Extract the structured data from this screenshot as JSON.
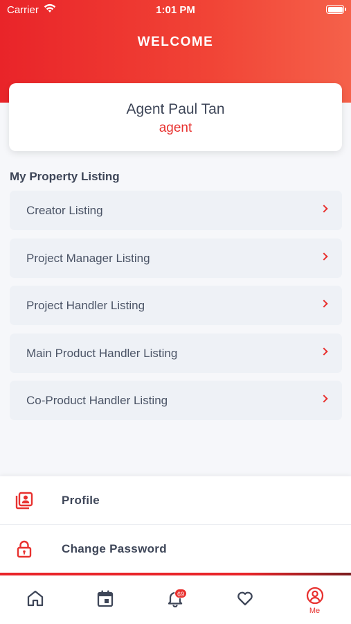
{
  "status_bar": {
    "carrier": "Carrier",
    "time": "1:01 PM"
  },
  "header": {
    "title": "WELCOME"
  },
  "user": {
    "name": "Agent Paul Tan",
    "role": "agent"
  },
  "listing_section": {
    "title": "My Property Listing",
    "items": [
      {
        "label": "Creator Listing"
      },
      {
        "label": "Project Manager Listing"
      },
      {
        "label": "Project Handler Listing"
      },
      {
        "label": "Main Product Handler Listing"
      },
      {
        "label": "Co-Product Handler Listing"
      }
    ]
  },
  "menu": {
    "profile": "Profile",
    "change_password": "Change Password"
  },
  "tabbar": {
    "notification_count": "69",
    "me_label": "Me"
  },
  "colors": {
    "accent": "#e8312f",
    "header_start": "#e92429",
    "header_end": "#f5614a",
    "icon_dark": "#3e4658"
  },
  "icons": [
    "wifi-icon",
    "battery-icon",
    "chevron-right-icon",
    "profile-icon",
    "lock-icon",
    "home-icon",
    "calendar-icon",
    "bell-icon",
    "heart-icon",
    "user-circle-icon"
  ]
}
